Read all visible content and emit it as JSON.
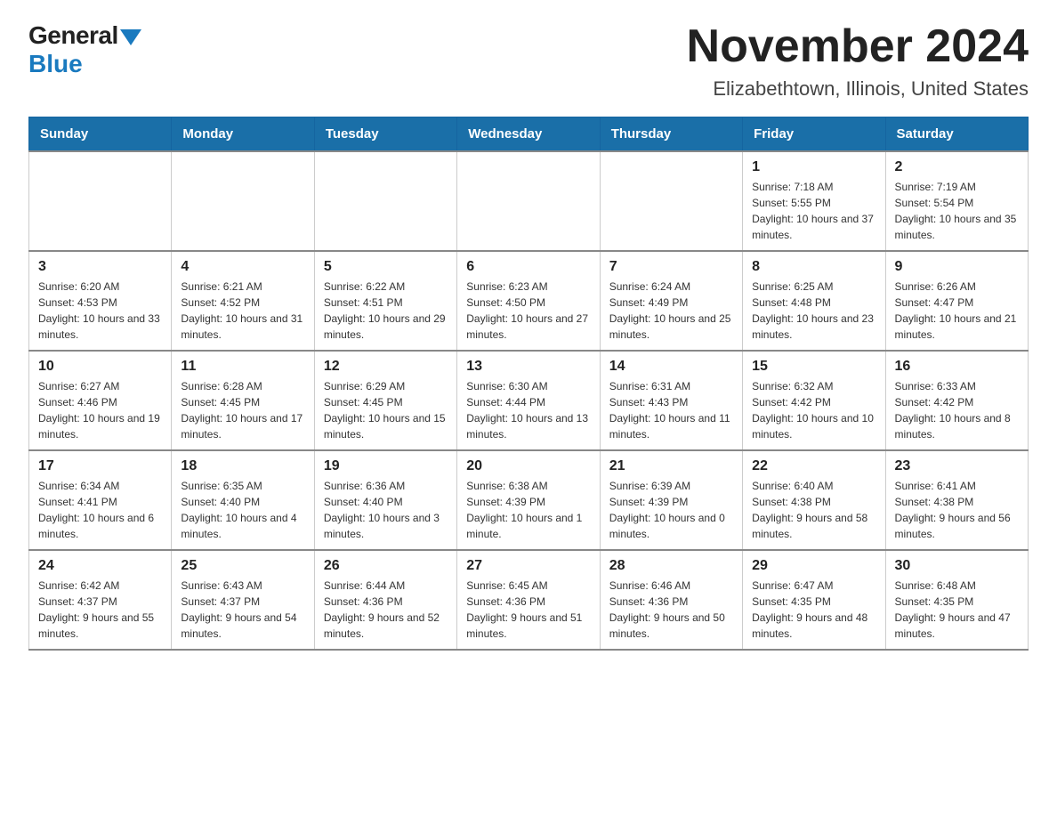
{
  "logo": {
    "general": "General",
    "blue": "Blue"
  },
  "header": {
    "title": "November 2024",
    "subtitle": "Elizabethtown, Illinois, United States"
  },
  "days_of_week": [
    "Sunday",
    "Monday",
    "Tuesday",
    "Wednesday",
    "Thursday",
    "Friday",
    "Saturday"
  ],
  "weeks": [
    [
      {
        "day": "",
        "info": ""
      },
      {
        "day": "",
        "info": ""
      },
      {
        "day": "",
        "info": ""
      },
      {
        "day": "",
        "info": ""
      },
      {
        "day": "",
        "info": ""
      },
      {
        "day": "1",
        "info": "Sunrise: 7:18 AM\nSunset: 5:55 PM\nDaylight: 10 hours and 37 minutes."
      },
      {
        "day": "2",
        "info": "Sunrise: 7:19 AM\nSunset: 5:54 PM\nDaylight: 10 hours and 35 minutes."
      }
    ],
    [
      {
        "day": "3",
        "info": "Sunrise: 6:20 AM\nSunset: 4:53 PM\nDaylight: 10 hours and 33 minutes."
      },
      {
        "day": "4",
        "info": "Sunrise: 6:21 AM\nSunset: 4:52 PM\nDaylight: 10 hours and 31 minutes."
      },
      {
        "day": "5",
        "info": "Sunrise: 6:22 AM\nSunset: 4:51 PM\nDaylight: 10 hours and 29 minutes."
      },
      {
        "day": "6",
        "info": "Sunrise: 6:23 AM\nSunset: 4:50 PM\nDaylight: 10 hours and 27 minutes."
      },
      {
        "day": "7",
        "info": "Sunrise: 6:24 AM\nSunset: 4:49 PM\nDaylight: 10 hours and 25 minutes."
      },
      {
        "day": "8",
        "info": "Sunrise: 6:25 AM\nSunset: 4:48 PM\nDaylight: 10 hours and 23 minutes."
      },
      {
        "day": "9",
        "info": "Sunrise: 6:26 AM\nSunset: 4:47 PM\nDaylight: 10 hours and 21 minutes."
      }
    ],
    [
      {
        "day": "10",
        "info": "Sunrise: 6:27 AM\nSunset: 4:46 PM\nDaylight: 10 hours and 19 minutes."
      },
      {
        "day": "11",
        "info": "Sunrise: 6:28 AM\nSunset: 4:45 PM\nDaylight: 10 hours and 17 minutes."
      },
      {
        "day": "12",
        "info": "Sunrise: 6:29 AM\nSunset: 4:45 PM\nDaylight: 10 hours and 15 minutes."
      },
      {
        "day": "13",
        "info": "Sunrise: 6:30 AM\nSunset: 4:44 PM\nDaylight: 10 hours and 13 minutes."
      },
      {
        "day": "14",
        "info": "Sunrise: 6:31 AM\nSunset: 4:43 PM\nDaylight: 10 hours and 11 minutes."
      },
      {
        "day": "15",
        "info": "Sunrise: 6:32 AM\nSunset: 4:42 PM\nDaylight: 10 hours and 10 minutes."
      },
      {
        "day": "16",
        "info": "Sunrise: 6:33 AM\nSunset: 4:42 PM\nDaylight: 10 hours and 8 minutes."
      }
    ],
    [
      {
        "day": "17",
        "info": "Sunrise: 6:34 AM\nSunset: 4:41 PM\nDaylight: 10 hours and 6 minutes."
      },
      {
        "day": "18",
        "info": "Sunrise: 6:35 AM\nSunset: 4:40 PM\nDaylight: 10 hours and 4 minutes."
      },
      {
        "day": "19",
        "info": "Sunrise: 6:36 AM\nSunset: 4:40 PM\nDaylight: 10 hours and 3 minutes."
      },
      {
        "day": "20",
        "info": "Sunrise: 6:38 AM\nSunset: 4:39 PM\nDaylight: 10 hours and 1 minute."
      },
      {
        "day": "21",
        "info": "Sunrise: 6:39 AM\nSunset: 4:39 PM\nDaylight: 10 hours and 0 minutes."
      },
      {
        "day": "22",
        "info": "Sunrise: 6:40 AM\nSunset: 4:38 PM\nDaylight: 9 hours and 58 minutes."
      },
      {
        "day": "23",
        "info": "Sunrise: 6:41 AM\nSunset: 4:38 PM\nDaylight: 9 hours and 56 minutes."
      }
    ],
    [
      {
        "day": "24",
        "info": "Sunrise: 6:42 AM\nSunset: 4:37 PM\nDaylight: 9 hours and 55 minutes."
      },
      {
        "day": "25",
        "info": "Sunrise: 6:43 AM\nSunset: 4:37 PM\nDaylight: 9 hours and 54 minutes."
      },
      {
        "day": "26",
        "info": "Sunrise: 6:44 AM\nSunset: 4:36 PM\nDaylight: 9 hours and 52 minutes."
      },
      {
        "day": "27",
        "info": "Sunrise: 6:45 AM\nSunset: 4:36 PM\nDaylight: 9 hours and 51 minutes."
      },
      {
        "day": "28",
        "info": "Sunrise: 6:46 AM\nSunset: 4:36 PM\nDaylight: 9 hours and 50 minutes."
      },
      {
        "day": "29",
        "info": "Sunrise: 6:47 AM\nSunset: 4:35 PM\nDaylight: 9 hours and 48 minutes."
      },
      {
        "day": "30",
        "info": "Sunrise: 6:48 AM\nSunset: 4:35 PM\nDaylight: 9 hours and 47 minutes."
      }
    ]
  ]
}
